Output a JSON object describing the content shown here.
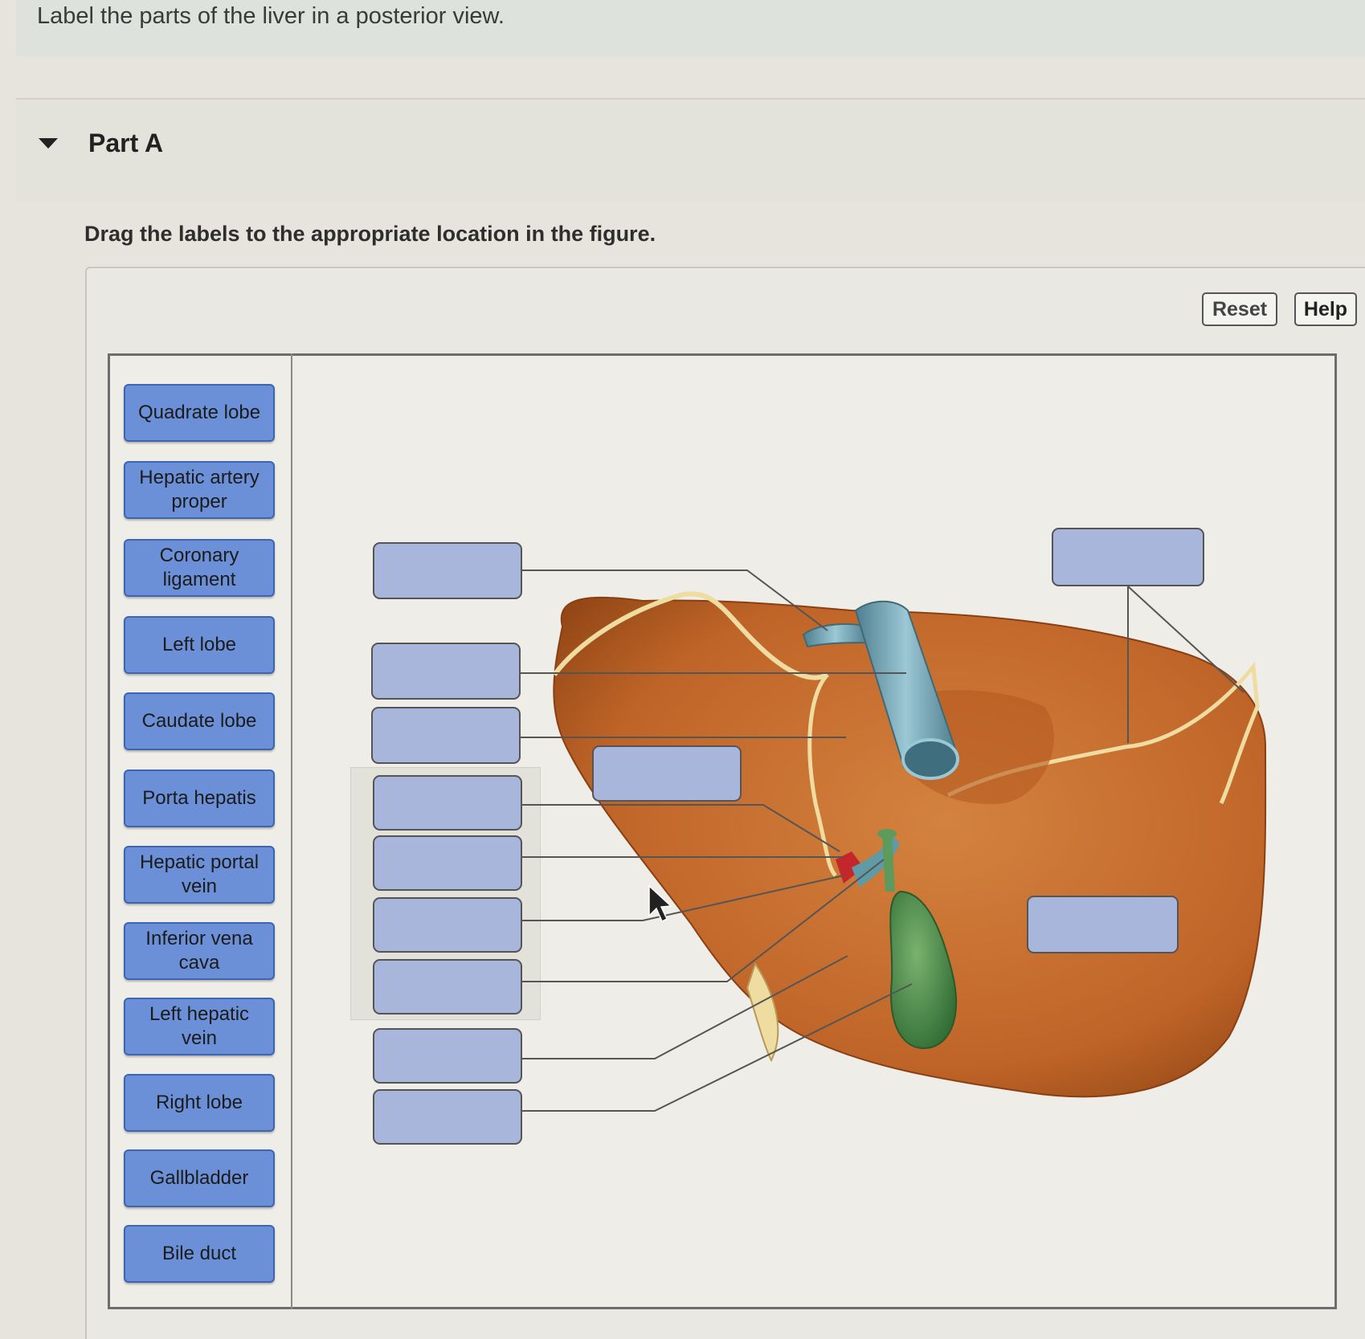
{
  "question": {
    "text": "Label the parts of the liver in a posterior view."
  },
  "part": {
    "title": "Part A",
    "instruction": "Drag the labels to the appropriate location in the figure."
  },
  "toolbar": {
    "reset_label": "Reset",
    "help_label": "Help"
  },
  "labels": [
    "Quadrate lobe",
    "Hepatic artery proper",
    "Coronary ligament",
    "Left lobe",
    "Caudate lobe",
    "Porta hepatis",
    "Hepatic portal vein",
    "Inferior vena cava",
    "Left hepatic vein",
    "Right lobe",
    "Gallbladder",
    "Bile duct"
  ],
  "colors": {
    "label_fill": "#6b90d7",
    "drop_zone_fill": "#a8b6db",
    "liver": "#c2692c",
    "vena_cava": "#6e9fb0",
    "gallbladder": "#4c8a4c"
  }
}
